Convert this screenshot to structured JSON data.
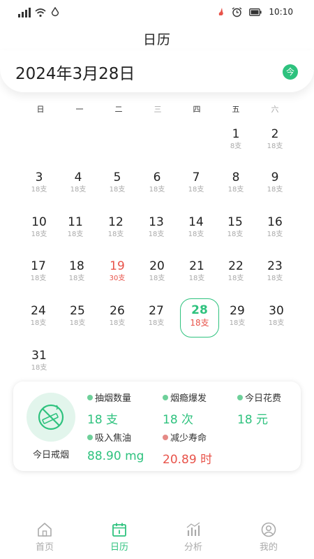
{
  "status_bar": {
    "time": "10:10"
  },
  "page_title": "日历",
  "date_header": {
    "date": "2024年3月28日",
    "today_button": "今"
  },
  "weekdays": [
    "日",
    "一",
    "二",
    "三",
    "四",
    "五",
    "六"
  ],
  "calendar": {
    "days": [
      {
        "day": "1",
        "count": "8支"
      },
      {
        "day": "2",
        "count": "18支"
      },
      {
        "day": "3",
        "count": "18支"
      },
      {
        "day": "4",
        "count": "18支"
      },
      {
        "day": "5",
        "count": "18支"
      },
      {
        "day": "6",
        "count": "18支"
      },
      {
        "day": "7",
        "count": "18支"
      },
      {
        "day": "8",
        "count": "18支"
      },
      {
        "day": "9",
        "count": "18支"
      },
      {
        "day": "10",
        "count": "18支"
      },
      {
        "day": "11",
        "count": "18支"
      },
      {
        "day": "12",
        "count": "18支"
      },
      {
        "day": "13",
        "count": "18支"
      },
      {
        "day": "14",
        "count": "18支"
      },
      {
        "day": "15",
        "count": "18支"
      },
      {
        "day": "16",
        "count": "18支"
      },
      {
        "day": "17",
        "count": "18支"
      },
      {
        "day": "18",
        "count": "18支"
      },
      {
        "day": "19",
        "count": "30支"
      },
      {
        "day": "20",
        "count": "18支"
      },
      {
        "day": "21",
        "count": "18支"
      },
      {
        "day": "22",
        "count": "18支"
      },
      {
        "day": "23",
        "count": "18支"
      },
      {
        "day": "24",
        "count": "18支"
      },
      {
        "day": "25",
        "count": "18支"
      },
      {
        "day": "26",
        "count": "18支"
      },
      {
        "day": "27",
        "count": "18支"
      },
      {
        "day": "28",
        "count": "18支"
      },
      {
        "day": "29",
        "count": "18支"
      },
      {
        "day": "30",
        "count": "18支"
      },
      {
        "day": "31",
        "count": "18支"
      }
    ]
  },
  "stats": {
    "quit_label": "今日戒烟",
    "cigarettes": {
      "label": "抽烟数量",
      "value": "18 支"
    },
    "cravings": {
      "label": "烟瘾爆发",
      "value": "18 次"
    },
    "cost": {
      "label": "今日花费",
      "value": "18 元"
    },
    "tar": {
      "label": "吸入焦油",
      "value": "88.90 mg"
    },
    "life_lost": {
      "label": "减少寿命",
      "value": "20.89 时"
    }
  },
  "nav": {
    "home": "首页",
    "calendar": "日历",
    "analysis": "分析",
    "mine": "我的"
  },
  "colors": {
    "accent": "#2ec27e",
    "warning": "#e8534a",
    "muted": "#aaaaaa"
  }
}
